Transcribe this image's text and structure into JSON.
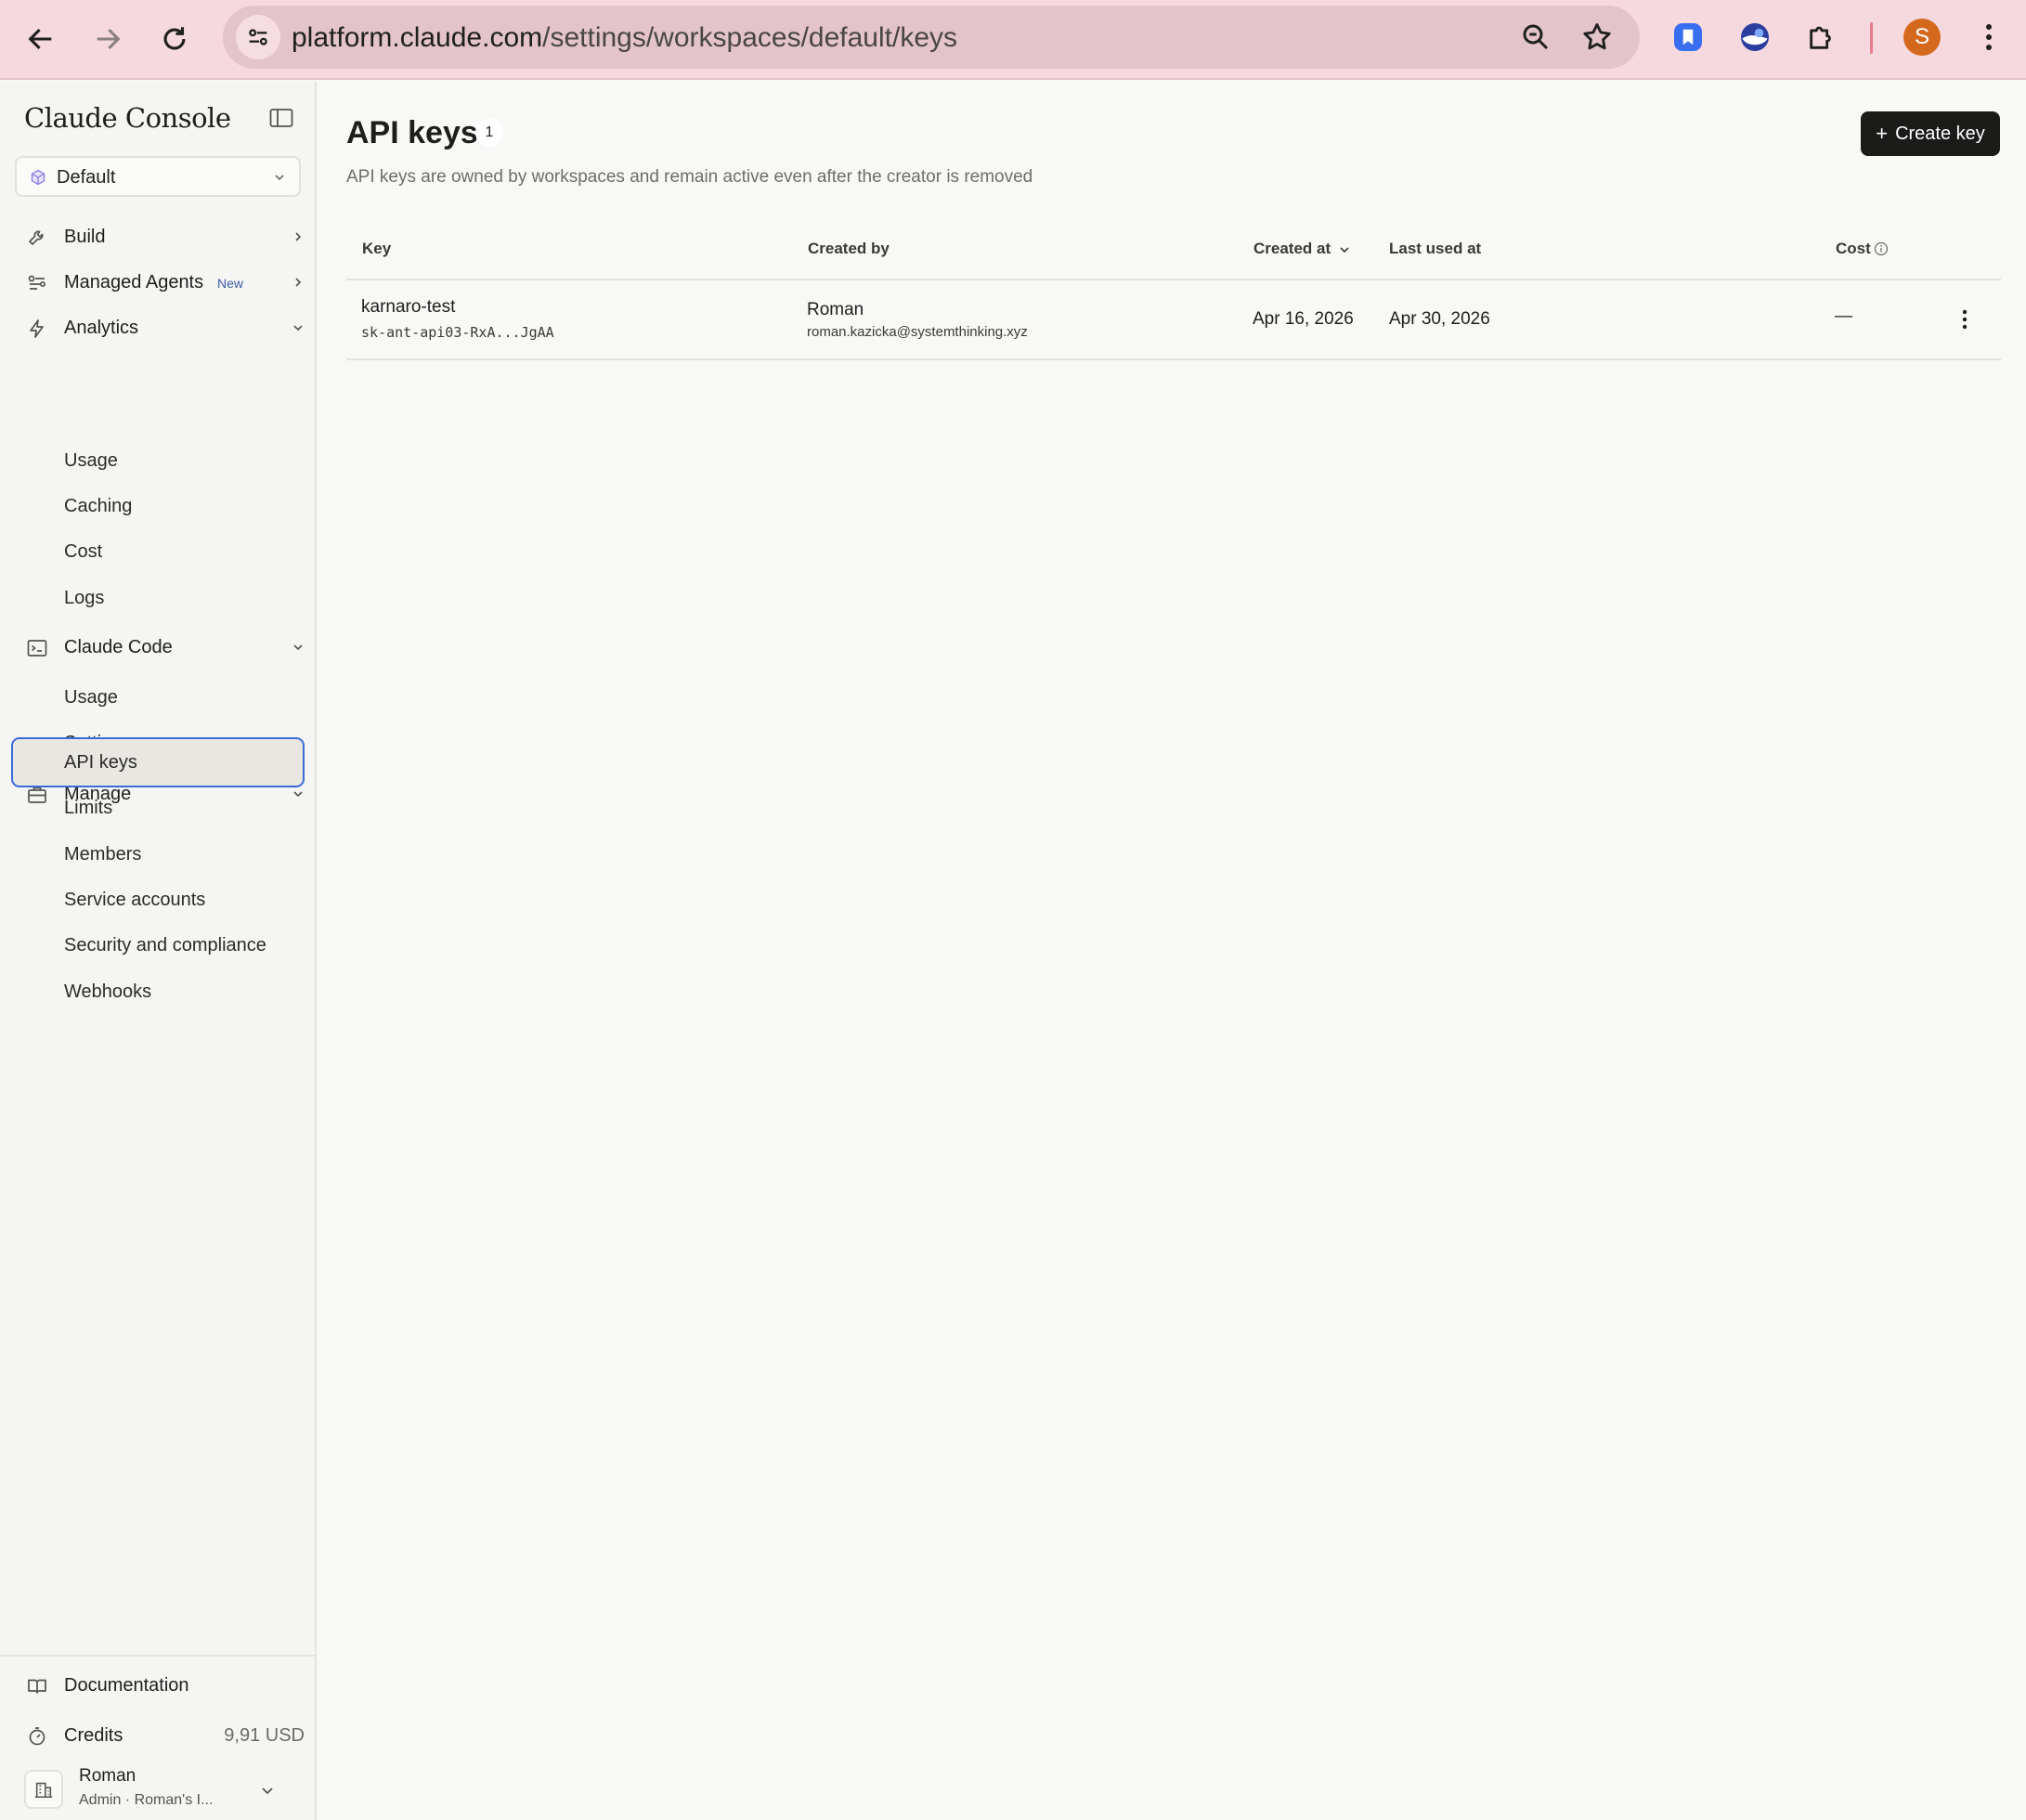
{
  "browser": {
    "url_host": "platform.claude.com",
    "url_path": "/settings/workspaces/default/keys",
    "profile_initial": "S"
  },
  "sidebar": {
    "brand": "Claude Console",
    "workspace": "Default",
    "build_label": "Build",
    "managed_agents_label": "Managed Agents",
    "managed_agents_badge": "New",
    "analytics_label": "Analytics",
    "analytics_items": [
      "Usage",
      "Caching",
      "Cost",
      "Logs"
    ],
    "claude_code_label": "Claude Code",
    "claude_code_items": [
      "Usage",
      "Settings"
    ],
    "manage_label": "Manage",
    "manage_items": [
      "API keys",
      "Limits",
      "Members",
      "Service accounts",
      "Security and compliance",
      "Webhooks"
    ],
    "documentation_label": "Documentation",
    "credits_label": "Credits",
    "credits_value": "9,91 USD",
    "user_name": "Roman",
    "user_role": "Admin · Roman's I..."
  },
  "main": {
    "title": "API keys",
    "count": "1",
    "subtitle": "API keys are owned by workspaces and remain active even after the creator is removed",
    "create_button": "Create key",
    "columns": {
      "key": "Key",
      "created_by": "Created by",
      "created_at": "Created at",
      "last_used_at": "Last used at",
      "cost": "Cost"
    },
    "rows": [
      {
        "name": "karnaro-test",
        "masked": "sk-ant-api03-RxA...JgAA",
        "creator": "Roman",
        "creator_email": "roman.kazicka@systemthinking.xyz",
        "created_at": "Apr 16, 2026",
        "last_used_at": "Apr 30, 2026",
        "cost": "—"
      }
    ]
  },
  "colors": {
    "chrome": "#f6d9de",
    "accent_active": "#3c6bd8",
    "button_dark": "#1b1b1a",
    "profile": "#d4691e"
  }
}
